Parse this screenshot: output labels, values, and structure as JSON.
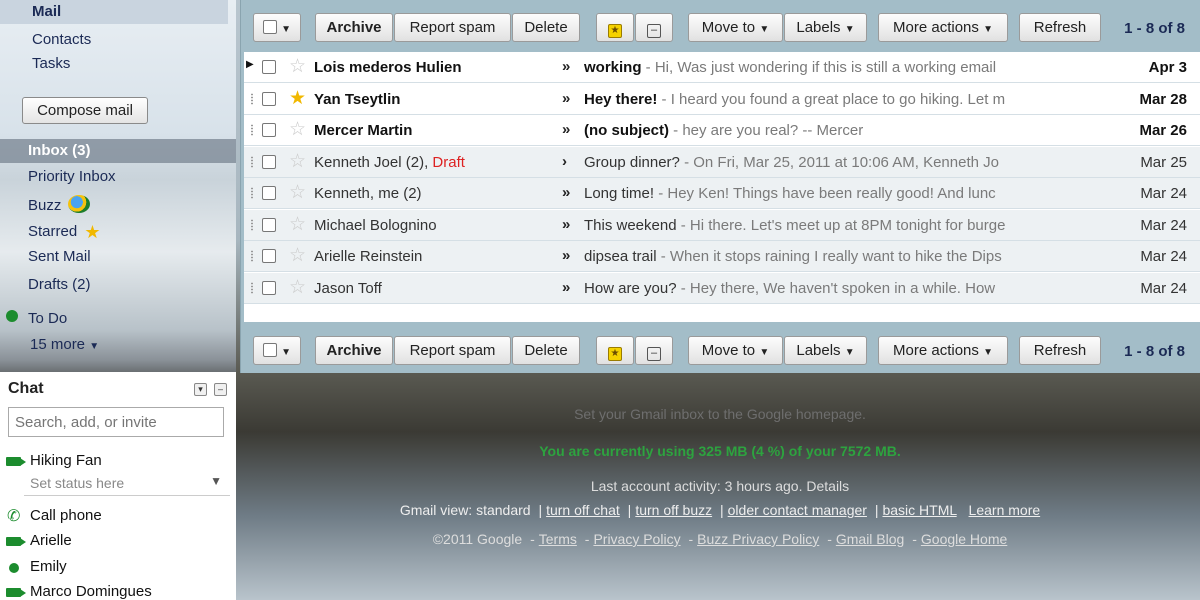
{
  "nav": {
    "mail": "Mail",
    "contacts": "Contacts",
    "tasks": "Tasks",
    "compose": "Compose mail"
  },
  "folders": {
    "inbox": "Inbox (3)",
    "priority": "Priority Inbox",
    "buzz": "Buzz",
    "starred": "Starred",
    "sent": "Sent Mail",
    "drafts": "Drafts (2)",
    "todo": "To Do",
    "more": "15 more"
  },
  "chat": {
    "title": "Chat",
    "search_placeholder": "Search, add, or invite",
    "status_placeholder": "Set status here",
    "contacts": [
      {
        "name": "Hiking Fan",
        "icon": "video-icon"
      },
      {
        "name": "Call phone",
        "icon": "phone-icon"
      },
      {
        "name": "Arielle",
        "icon": "video-icon"
      },
      {
        "name": "Emily",
        "icon": "online-dot-icon"
      },
      {
        "name": "Marco Domingues",
        "icon": "video-icon"
      }
    ]
  },
  "toolbar": {
    "archive": "Archive",
    "report_spam": "Report spam",
    "delete": "Delete",
    "move_to": "Move to",
    "labels": "Labels",
    "more_actions": "More actions",
    "refresh": "Refresh",
    "range": "1 - 8 of 8"
  },
  "messages": [
    {
      "sender": "Lois mederos Hulien",
      "draft": "",
      "subject": "working",
      "snippet": " - Hi, Was just wondering if this is still a working email",
      "date": "Apr 3",
      "unread": true,
      "starred": false,
      "chev": "»"
    },
    {
      "sender": "Yan Tseytlin",
      "draft": "",
      "subject": "Hey there!",
      "snippet": " - I heard you found a great place to go hiking. Let m",
      "date": "Mar 28",
      "unread": true,
      "starred": true,
      "chev": "»"
    },
    {
      "sender": "Mercer Martin",
      "draft": "",
      "subject": "(no subject)",
      "snippet": " - hey are you real? -- Mercer",
      "date": "Mar 26",
      "unread": true,
      "starred": false,
      "chev": "»"
    },
    {
      "sender": "Kenneth Joel (2), ",
      "draft": "Draft",
      "subject": "Group dinner?",
      "snippet": " - On Fri, Mar 25, 2011 at 10:06 AM, Kenneth Jo",
      "date": "Mar 25",
      "unread": false,
      "starred": false,
      "chev": "›"
    },
    {
      "sender": "Kenneth, me (2)",
      "draft": "",
      "subject": "Long time!",
      "snippet": " - Hey Ken! Things have been really good! And lunc",
      "date": "Mar 24",
      "unread": false,
      "starred": false,
      "chev": "»"
    },
    {
      "sender": "Michael Bolognino",
      "draft": "",
      "subject": "This weekend",
      "snippet": " - Hi there. Let's meet up at 8PM tonight for burge",
      "date": "Mar 24",
      "unread": false,
      "starred": false,
      "chev": "»"
    },
    {
      "sender": "Arielle Reinstein",
      "draft": "",
      "subject": "dipsea trail",
      "snippet": " - When it stops raining I really want to hike the Dips",
      "date": "Mar 24",
      "unread": false,
      "starred": false,
      "chev": "»"
    },
    {
      "sender": "Jason Toff",
      "draft": "",
      "subject": "How are you?",
      "snippet": " - Hey there, We haven't spoken in a while. How",
      "date": "Mar 24",
      "unread": false,
      "starred": false,
      "chev": "»"
    }
  ],
  "footer": {
    "set_home": "Set your Gmail inbox to the Google homepage.",
    "usage": "You are currently using 325 MB (4 %) of your 7572 MB.",
    "activity": "Last account activity: 3 hours ago. Details",
    "view_prefix": "Gmail view: standard",
    "view_links": [
      "turn off chat",
      "turn off buzz",
      "older contact manager",
      "basic HTML",
      "Learn more"
    ],
    "copyright": "©2011 Google",
    "links": [
      "Terms",
      "Privacy Policy",
      "Buzz Privacy Policy",
      "Gmail Blog",
      "Google Home"
    ]
  },
  "colors": {
    "pane_bg": "#a3bdc8",
    "usage_green": "#2da33f",
    "draft_red": "#dd2222",
    "star_gold": "#f1b800"
  }
}
